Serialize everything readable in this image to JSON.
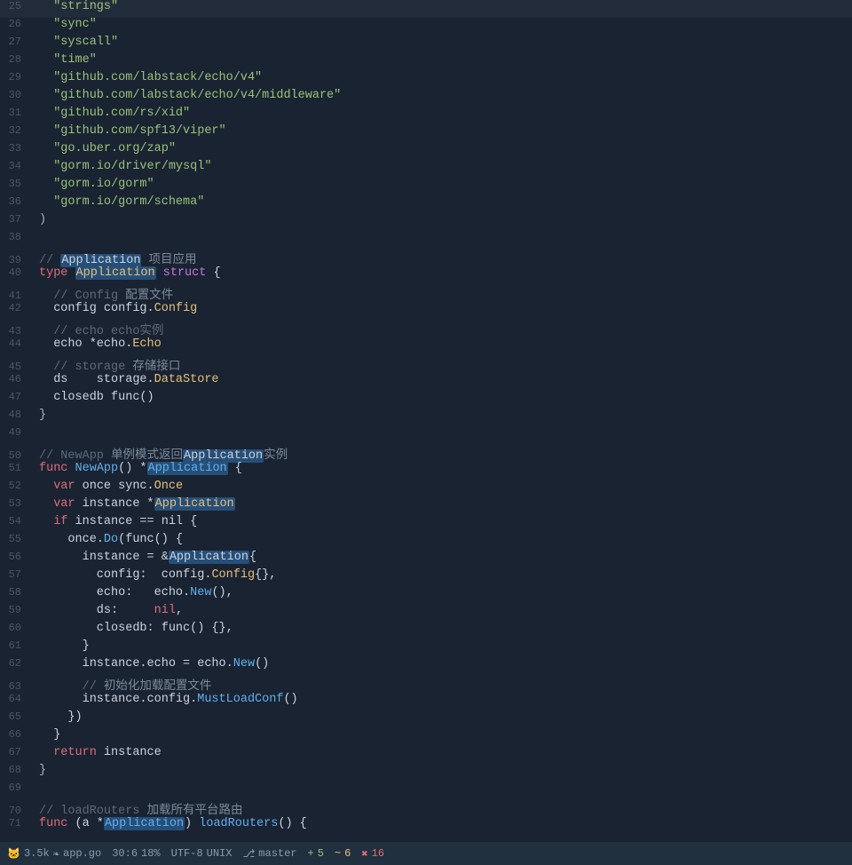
{
  "editor": {
    "background": "#1a2332",
    "lines": [
      {
        "num": 25,
        "gutter": "",
        "tokens": [
          {
            "t": "str",
            "v": "  \"strings\""
          },
          {
            "t": "punct",
            "v": ""
          }
        ]
      },
      {
        "num": 26,
        "gutter": "",
        "tokens": [
          {
            "t": "str",
            "v": "  \"sync\""
          },
          {
            "t": "punct",
            "v": ""
          }
        ]
      },
      {
        "num": 27,
        "gutter": "",
        "tokens": [
          {
            "t": "str",
            "v": "  \"syscall\""
          },
          {
            "t": "punct",
            "v": ""
          }
        ]
      },
      {
        "num": 28,
        "gutter": "red",
        "tokens": [
          {
            "t": "str",
            "v": "  \"time\""
          },
          {
            "t": "punct",
            "v": ""
          }
        ]
      },
      {
        "num": 29,
        "gutter": "",
        "tokens": [
          {
            "t": "str",
            "v": "  \"github.com/labstack/echo/v4\""
          }
        ]
      },
      {
        "num": 30,
        "gutter": "",
        "tokens": [
          {
            "t": "str",
            "v": "  \"github.com/labstack/echo/v4/middleware\""
          }
        ]
      },
      {
        "num": 31,
        "gutter": "",
        "tokens": [
          {
            "t": "str",
            "v": "  \"github.com/rs/xid\""
          }
        ]
      },
      {
        "num": 32,
        "gutter": "",
        "tokens": [
          {
            "t": "str",
            "v": "  \"github.com/spf13/viper\""
          }
        ]
      },
      {
        "num": 33,
        "gutter": "",
        "tokens": [
          {
            "t": "str",
            "v": "  \"go.uber.org/zap\""
          }
        ]
      },
      {
        "num": 34,
        "gutter": "",
        "tokens": [
          {
            "t": "str",
            "v": "  \"gorm.io/driver/mysql\""
          }
        ]
      },
      {
        "num": 35,
        "gutter": "",
        "tokens": [
          {
            "t": "str",
            "v": "  \"gorm.io/gorm\""
          }
        ]
      },
      {
        "num": 36,
        "gutter": "",
        "tokens": [
          {
            "t": "str",
            "v": "  \"gorm.io/gorm/schema\""
          }
        ]
      },
      {
        "num": 37,
        "gutter": "",
        "tokens": [
          {
            "t": "punct",
            "v": ")"
          }
        ]
      },
      {
        "num": 38,
        "gutter": "",
        "tokens": []
      },
      {
        "num": 39,
        "gutter": "",
        "tokens": [
          {
            "t": "comment",
            "v": "// "
          },
          {
            "t": "hl-box",
            "v": "Application"
          },
          {
            "t": "comment-cn",
            "v": " 项目应用"
          }
        ]
      },
      {
        "num": 40,
        "gutter": "",
        "tokens": [
          {
            "t": "kw",
            "v": "type "
          },
          {
            "t": "hl-orange",
            "v": "Application"
          },
          {
            "t": "plain",
            "v": " "
          },
          {
            "t": "struct-kw",
            "v": "struct"
          },
          {
            "t": "plain",
            "v": " {"
          }
        ]
      },
      {
        "num": 41,
        "gutter": "",
        "tokens": [
          {
            "t": "comment",
            "v": "  // Config "
          },
          {
            "t": "comment-cn",
            "v": "配置文件"
          }
        ]
      },
      {
        "num": 42,
        "gutter": "",
        "tokens": [
          {
            "t": "plain",
            "v": "  config config."
          },
          {
            "t": "type-name",
            "v": "Config"
          }
        ]
      },
      {
        "num": 43,
        "gutter": "",
        "tokens": [
          {
            "t": "comment",
            "v": "  // echo echo实例"
          }
        ]
      },
      {
        "num": 44,
        "gutter": "",
        "tokens": [
          {
            "t": "plain",
            "v": "  echo *echo."
          },
          {
            "t": "type-name",
            "v": "Echo"
          }
        ]
      },
      {
        "num": 45,
        "gutter": "",
        "tokens": [
          {
            "t": "comment",
            "v": "  // storage "
          },
          {
            "t": "comment-cn",
            "v": "存储接口"
          }
        ]
      },
      {
        "num": 46,
        "gutter": "",
        "tokens": [
          {
            "t": "plain",
            "v": "  ds    storage."
          },
          {
            "t": "type-name",
            "v": "DataStore"
          }
        ]
      },
      {
        "num": 47,
        "gutter": "",
        "tokens": [
          {
            "t": "plain",
            "v": "  closedb func()"
          }
        ]
      },
      {
        "num": 48,
        "gutter": "",
        "tokens": [
          {
            "t": "punct",
            "v": "}"
          }
        ]
      },
      {
        "num": 49,
        "gutter": "",
        "tokens": []
      },
      {
        "num": 50,
        "gutter": "",
        "tokens": [
          {
            "t": "comment",
            "v": "// NewApp "
          },
          {
            "t": "comment-cn",
            "v": "单例模式返回"
          },
          {
            "t": "hl-box",
            "v": "Application"
          },
          {
            "t": "comment-cn",
            "v": "实例"
          }
        ]
      },
      {
        "num": 51,
        "gutter": "",
        "tokens": [
          {
            "t": "kw",
            "v": "func "
          },
          {
            "t": "kw-blue",
            "v": "NewApp"
          },
          {
            "t": "plain",
            "v": "() *"
          },
          {
            "t": "hl-blue",
            "v": "Application"
          },
          {
            "t": "plain",
            "v": " {"
          }
        ]
      },
      {
        "num": 52,
        "gutter": "",
        "tokens": [
          {
            "t": "plain",
            "v": "  "
          },
          {
            "t": "kw",
            "v": "var"
          },
          {
            "t": "plain",
            "v": " once sync."
          },
          {
            "t": "type-name",
            "v": "Once"
          }
        ]
      },
      {
        "num": 53,
        "gutter": "",
        "tokens": [
          {
            "t": "plain",
            "v": "  "
          },
          {
            "t": "kw",
            "v": "var"
          },
          {
            "t": "plain",
            "v": " instance *"
          },
          {
            "t": "hl-box2",
            "v": "Application"
          }
        ]
      },
      {
        "num": 54,
        "gutter": "",
        "tokens": [
          {
            "t": "plain",
            "v": "  "
          },
          {
            "t": "kw",
            "v": "if"
          },
          {
            "t": "plain",
            "v": " instance == nil {"
          }
        ]
      },
      {
        "num": 55,
        "gutter": "blue",
        "tokens": [
          {
            "t": "plain",
            "v": "    once."
          },
          {
            "t": "method",
            "v": "Do"
          },
          {
            "t": "plain",
            "v": "(func() {"
          }
        ]
      },
      {
        "num": 56,
        "gutter": "blue",
        "tokens": [
          {
            "t": "plain",
            "v": "      instance = &"
          },
          {
            "t": "hl-box3",
            "v": "Application"
          },
          {
            "t": "plain",
            "v": "{"
          }
        ]
      },
      {
        "num": 57,
        "gutter": "",
        "tokens": [
          {
            "t": "plain",
            "v": "        config:  config."
          },
          {
            "t": "type-name",
            "v": "Config"
          },
          {
            "t": "plain",
            "v": "{},"
          },
          {
            "t": "punct",
            "v": ""
          }
        ]
      },
      {
        "num": 58,
        "gutter": "",
        "tokens": [
          {
            "t": "plain",
            "v": "        echo:   echo."
          },
          {
            "t": "method",
            "v": "New"
          },
          {
            "t": "plain",
            "v": "(),"
          }
        ]
      },
      {
        "num": 59,
        "gutter": "",
        "tokens": [
          {
            "t": "plain",
            "v": "        ds:     "
          },
          {
            "t": "nil",
            "v": "nil"
          },
          {
            "t": "plain",
            "v": ","
          }
        ]
      },
      {
        "num": 60,
        "gutter": "",
        "tokens": [
          {
            "t": "plain",
            "v": "        closedb: func() {},"
          },
          {
            "t": "punct",
            "v": ""
          }
        ]
      },
      {
        "num": 61,
        "gutter": "",
        "tokens": [
          {
            "t": "plain",
            "v": "      }"
          }
        ]
      },
      {
        "num": 62,
        "gutter": "",
        "tokens": [
          {
            "t": "plain",
            "v": "      instance.echo = echo."
          },
          {
            "t": "method",
            "v": "New"
          },
          {
            "t": "plain",
            "v": "()"
          }
        ]
      },
      {
        "num": 63,
        "gutter": "",
        "tokens": [
          {
            "t": "comment",
            "v": "      // "
          },
          {
            "t": "comment-cn",
            "v": "初始化加载配置文件"
          }
        ]
      },
      {
        "num": 64,
        "gutter": "",
        "tokens": [
          {
            "t": "plain",
            "v": "      instance.config."
          },
          {
            "t": "method",
            "v": "MustLoadConf"
          },
          {
            "t": "plain",
            "v": "()"
          }
        ]
      },
      {
        "num": 65,
        "gutter": "",
        "tokens": [
          {
            "t": "plain",
            "v": "    })"
          }
        ]
      },
      {
        "num": 66,
        "gutter": "",
        "tokens": [
          {
            "t": "plain",
            "v": "  }"
          }
        ]
      },
      {
        "num": 67,
        "gutter": "",
        "tokens": [
          {
            "t": "plain",
            "v": "  "
          },
          {
            "t": "kw",
            "v": "return"
          },
          {
            "t": "plain",
            "v": " instance"
          }
        ]
      },
      {
        "num": 68,
        "gutter": "",
        "tokens": [
          {
            "t": "punct",
            "v": "}"
          }
        ]
      },
      {
        "num": 69,
        "gutter": "",
        "tokens": []
      },
      {
        "num": 70,
        "gutter": "",
        "tokens": [
          {
            "t": "comment",
            "v": "// loadRouters "
          },
          {
            "t": "comment-cn",
            "v": "加载所有平台路由"
          }
        ]
      },
      {
        "num": 71,
        "gutter": "",
        "tokens": [
          {
            "t": "kw",
            "v": "func"
          },
          {
            "t": "plain",
            "v": " (a *"
          },
          {
            "t": "hl-blue2",
            "v": "Application"
          },
          {
            "t": "plain",
            "v": ") "
          },
          {
            "t": "method",
            "v": "loadRouters"
          },
          {
            "t": "plain",
            "v": "() {"
          }
        ]
      }
    ],
    "status_bar": {
      "icon": "🐱",
      "file_info": "3.5k",
      "filename": "app.go",
      "position": "30:6",
      "percent": "18%",
      "encoding": "UTF-8",
      "line_ending": "UNIX",
      "branch_icon": "⎇",
      "branch": "master",
      "added": "5",
      "changed": "6",
      "errors": "16"
    }
  }
}
